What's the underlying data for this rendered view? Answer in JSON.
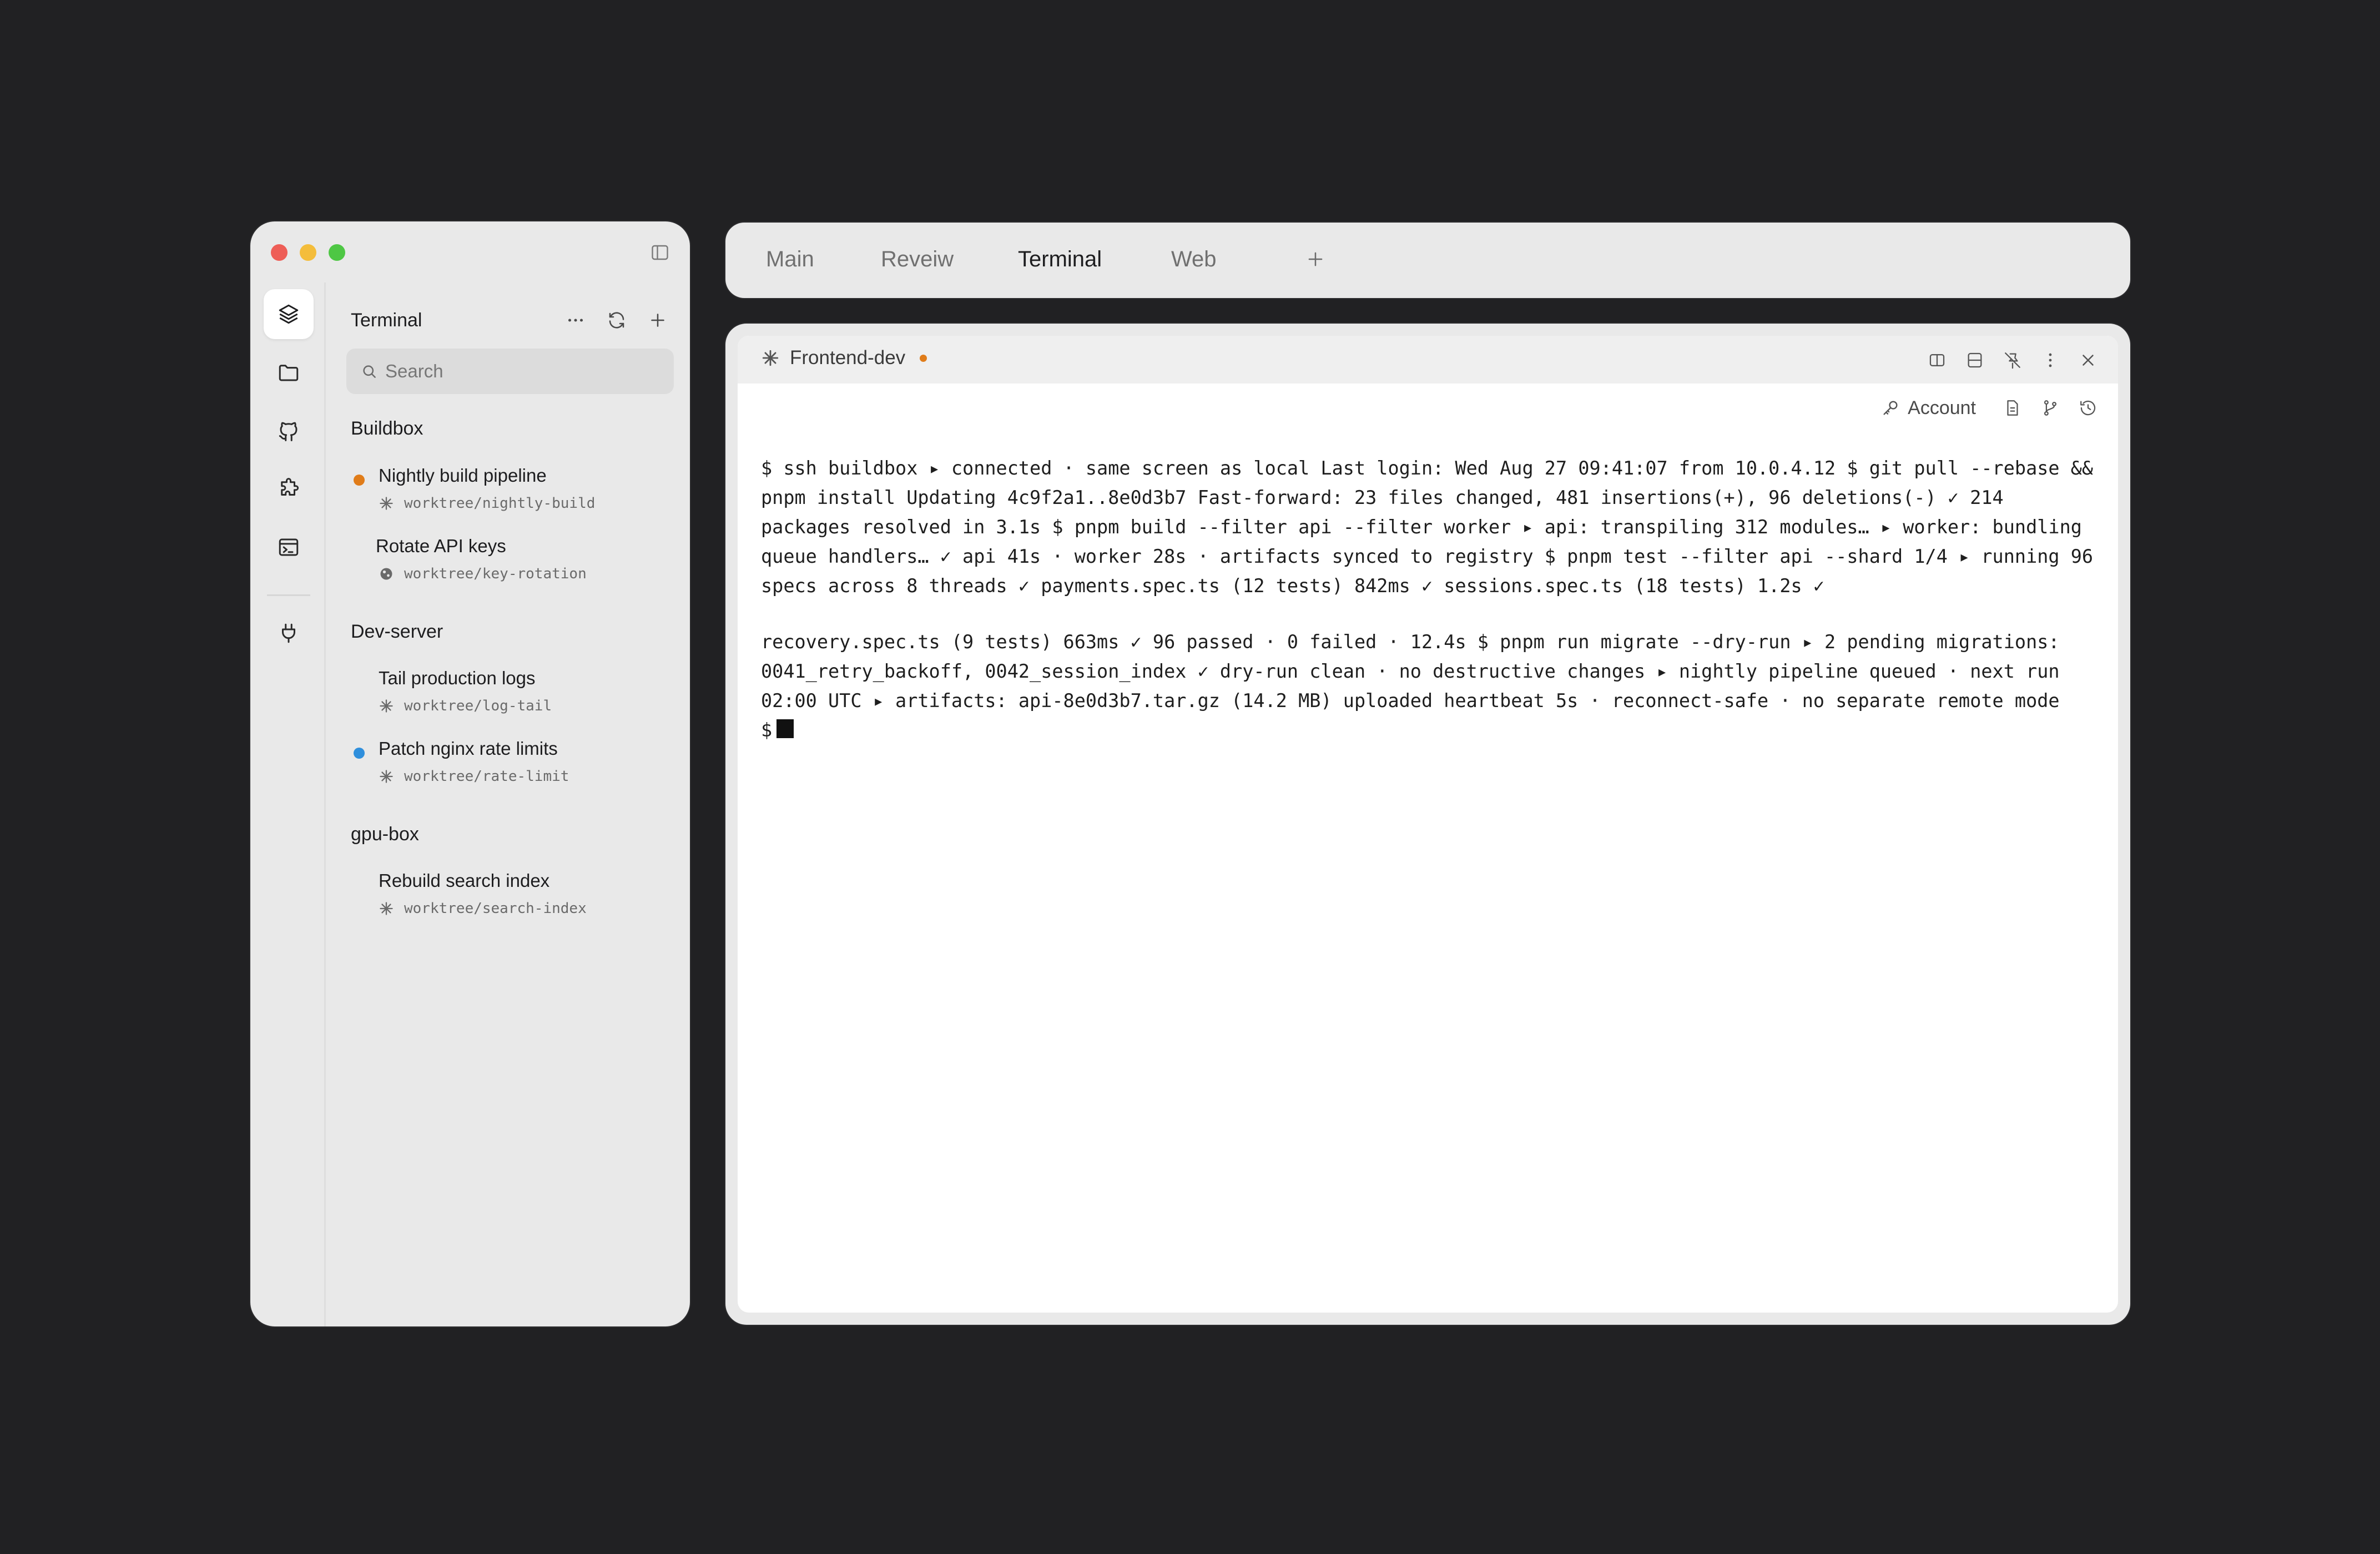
{
  "sidebar": {
    "title": "Terminal",
    "search_placeholder": "Search",
    "rail_icons": [
      "layers-icon",
      "folder-icon",
      "github-icon",
      "puzzle-icon",
      "terminal-window-icon",
      "plug-icon"
    ],
    "groups": [
      {
        "label": "Buildbox",
        "items": [
          {
            "title": "Nightly build pipeline",
            "branch": "worktree/nightly-build",
            "status": "orange"
          },
          {
            "title": "Rotate API keys",
            "branch": "worktree/key-rotation",
            "status": "none"
          }
        ]
      },
      {
        "label": "Dev-server",
        "items": [
          {
            "title": "Tail production logs",
            "branch": "worktree/log-tail",
            "status": "none"
          },
          {
            "title": "Patch nginx rate limits",
            "branch": "worktree/rate-limit",
            "status": "blue"
          }
        ]
      },
      {
        "label": "gpu-box",
        "items": [
          {
            "title": "Rebuild search index",
            "branch": "worktree/search-index",
            "status": "none"
          }
        ]
      }
    ]
  },
  "tabs": {
    "items": [
      "Main",
      "Reveiw",
      "Terminal",
      "Web"
    ],
    "active": "Terminal"
  },
  "terminal": {
    "session_name": "Frontend-dev",
    "account_label": "Account",
    "output_block_1": "$ ssh buildbox ▸ connected · same screen as local Last login: Wed Aug 27 09:41:07 from 10.0.4.12 $ git pull --rebase && pnpm install Updating 4c9f2a1..8e0d3b7 Fast-forward: 23 files changed, 481 insertions(+), 96 deletions(-) ✓ 214 packages resolved in 3.1s $ pnpm build --filter api --filter worker ▸ api: transpiling 312 modules… ▸ worker: bundling queue handlers… ✓ api 41s · worker 28s · artifacts synced to registry $ pnpm test --filter api --shard 1/4 ▸ running 96 specs across 8 threads ✓ payments.spec.ts (12 tests) 842ms ✓ sessions.spec.ts (18 tests) 1.2s ✓",
    "output_block_2": "recovery.spec.ts (9 tests) 663ms ✓ 96 passed · 0 failed · 12.4s $ pnpm run migrate --dry-run ▸ 2 pending migrations: 0041_retry_backoff, 0042_session_index ✓ dry-run clean · no destructive changes ▸ nightly pipeline queued · next run 02:00 UTC ▸ artifacts: api-8e0d3b7.tar.gz (14.2 MB) uploaded heartbeat 5s · reconnect-safe · no separate remote mode",
    "prompt": "$"
  },
  "colors": {
    "status_orange": "#e07c19",
    "status_blue": "#2f8fdc",
    "background": "#212123"
  }
}
